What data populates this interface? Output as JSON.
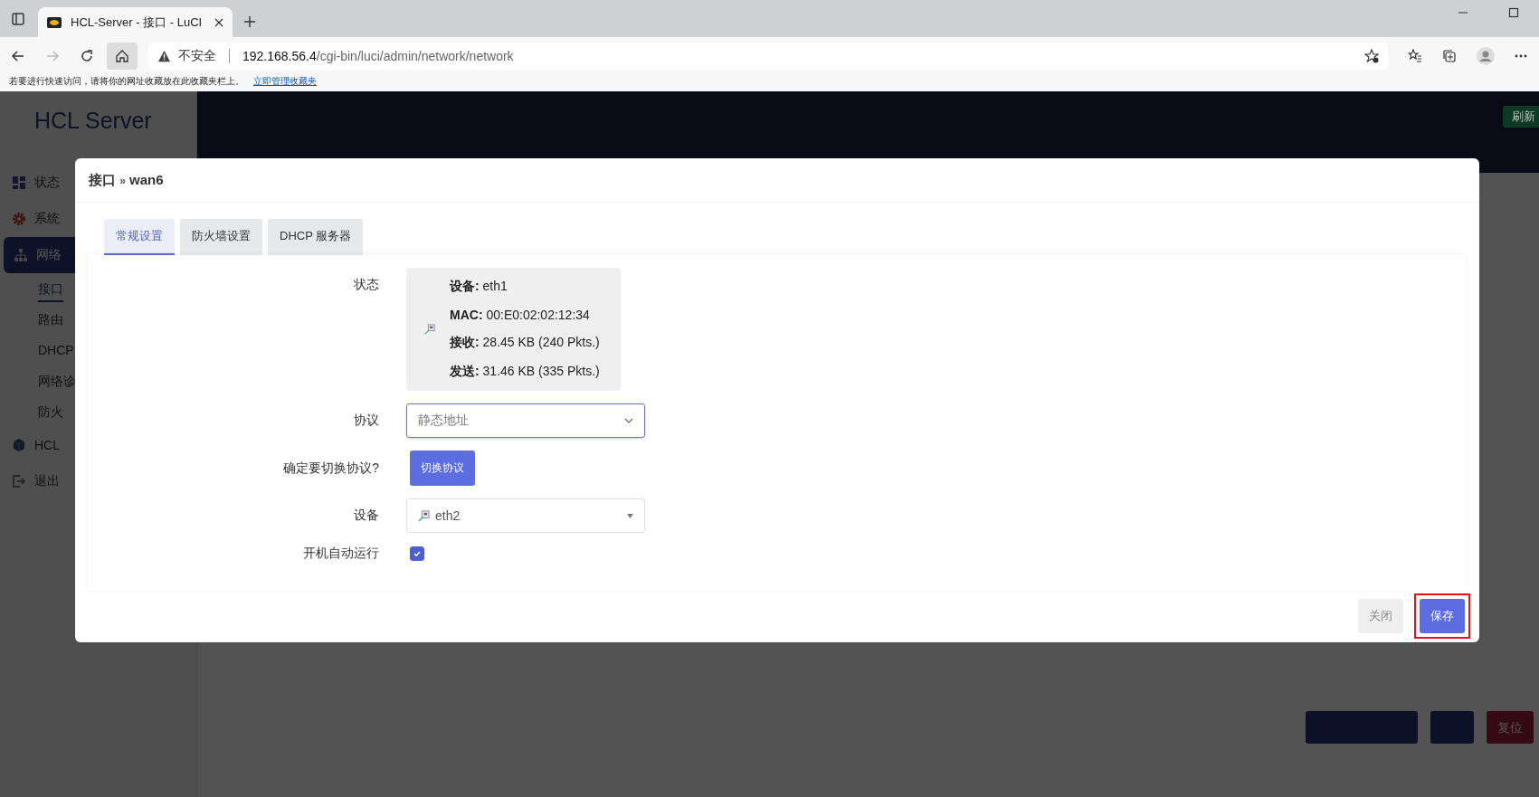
{
  "browser": {
    "tab_title": "HCL-Server - 接口 - LuCI",
    "security": "不安全",
    "url_host": "192.168.56.4",
    "url_path": "/cgi-bin/luci/admin/network/network",
    "favorites_hint": "若要进行快速访问，请将你的网址收藏放在此收藏夹栏上。",
    "favorites_link": "立即管理收藏夹"
  },
  "sidebar": {
    "brand": "HCL Server",
    "items": [
      {
        "label": "状态",
        "kind": "dashboard",
        "selected": false
      },
      {
        "label": "系统",
        "kind": "gear",
        "selected": false
      },
      {
        "label": "网络",
        "kind": "network",
        "selected": true,
        "children": [
          {
            "label": "接口",
            "selected": true
          },
          {
            "label": "路由",
            "selected": false
          },
          {
            "label": "DHCP",
            "selected": false
          },
          {
            "label": "网络诊",
            "selected": false
          },
          {
            "label": "防火",
            "selected": false
          }
        ]
      },
      {
        "label": "HCL",
        "kind": "cube",
        "selected": false
      },
      {
        "label": "退出",
        "kind": "logout",
        "selected": false
      }
    ]
  },
  "header": {
    "refresh_button": "刷新"
  },
  "page_buttons": [
    {
      "kind": "primary"
    },
    {
      "kind": "primary"
    },
    {
      "label": "复位",
      "kind": "danger"
    }
  ],
  "modal": {
    "title_prefix": "接口",
    "title_separator": "»",
    "title": "wan6",
    "tabs": [
      {
        "label": "常规设置",
        "selected": true
      },
      {
        "label": "防火墙设置",
        "selected": false
      },
      {
        "label": "DHCP 服务器",
        "selected": false
      }
    ],
    "status": {
      "label": "状态",
      "lines": [
        {
          "key": "设备:",
          "value": "eth1"
        },
        {
          "key": "MAC:",
          "value": "00:E0:02:02:12:34"
        },
        {
          "key": "接收:",
          "value": "28.45 KB (240 Pkts.)"
        },
        {
          "key": "发送:",
          "value": "31.46 KB (335 Pkts.)"
        }
      ]
    },
    "protocol": {
      "label": "协议",
      "value": "静态地址"
    },
    "switch": {
      "label": "确定要切换协议?",
      "button": "切换协议"
    },
    "device": {
      "label": "设备",
      "value": "eth2"
    },
    "autostart": {
      "label": "开机自动运行",
      "checked": true
    },
    "buttons": [
      {
        "label": "关闭",
        "kind": "secondary",
        "highlighted": false
      },
      {
        "label": "保存",
        "kind": "primary",
        "highlighted": true
      }
    ]
  }
}
